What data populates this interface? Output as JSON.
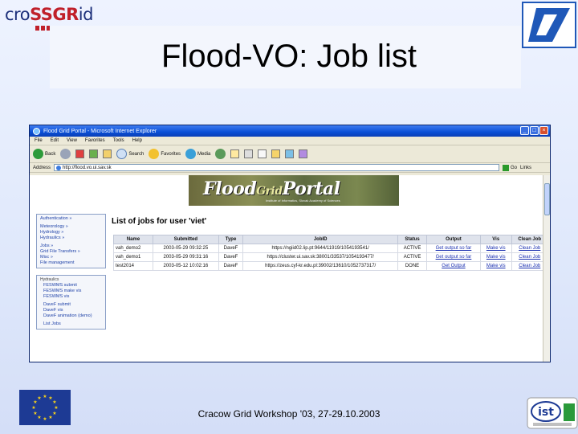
{
  "slide": {
    "logo_text_1": "cro",
    "logo_text_2": "SSGR",
    "logo_text_3": "id",
    "title": "Flood-VO: Job list",
    "footer": "Cracow Grid Workshop '03, 27-29.10.2003",
    "ist_logo_text": "ist"
  },
  "browser": {
    "window_title": "Flood Grid Portal - Microsoft Internet Explorer",
    "menu": [
      "File",
      "Edit",
      "View",
      "Favorites",
      "Tools",
      "Help"
    ],
    "toolbar": {
      "back": "Back",
      "search": "Search",
      "favorites": "Favorites",
      "media": "Media"
    },
    "address_label": "Address",
    "address_value": "http://flood.vo.ui.sav.sk",
    "go_label": "Go",
    "links_label": "Links"
  },
  "portal": {
    "banner_text_1": "Flood",
    "banner_text_2": "Grid",
    "banner_text_3": "Portal",
    "banner_subtitle": "Institute of Informatics, Slovak Academy of Sciences",
    "sidebar_top": [
      "Authentication »",
      "Meteorology »",
      "Hydrology »",
      "Hydraulics »",
      "Jobs »",
      "Grid File Transfers »",
      "Misc »",
      "File management"
    ],
    "sidebar_section_head": "Hydraulics",
    "sidebar_bottom": [
      "FESWMS submit",
      "FESWMS make vis",
      "FESWMS vis",
      "DaveF submit",
      "DaveF vis",
      "DaveF animation (demo)",
      "List Jobs"
    ],
    "jobs_title": "List of jobs for user 'viet'",
    "table": {
      "headers": [
        "Name",
        "Submitted",
        "Type",
        "JobID",
        "Status",
        "Output",
        "Vis",
        "Clean Job"
      ],
      "rows": [
        [
          "vah_demo2",
          "2003-05-29 09:32:25",
          "DaveF",
          "https://ngiid02.lip.pt:9644/11919/1054193541/",
          "ACTIVE",
          "Get output so far",
          "Make vis",
          "Clean Job"
        ],
        [
          "vah_demo1",
          "2003-05-29 09:31:16",
          "DaveF",
          "https://cluster.ui.sav.sk:38001/33537/1054193477/",
          "ACTIVE",
          "Get output so far",
          "Make vis",
          "Clean Job"
        ],
        [
          "test2014",
          "2003-05-12 10:02:16",
          "DaveF",
          "https://zeus.cyf-kr.edu.pl:39002/13610/1052737317/",
          "DONE",
          "Get Output",
          "Make vis",
          "Clean Job"
        ]
      ]
    }
  },
  "colors": {
    "slide_bg": "#dfe8fb",
    "link": "#1a2fb0",
    "xp_titlebar": "#0a4fd6",
    "eu_flag": "#1d3a94"
  }
}
